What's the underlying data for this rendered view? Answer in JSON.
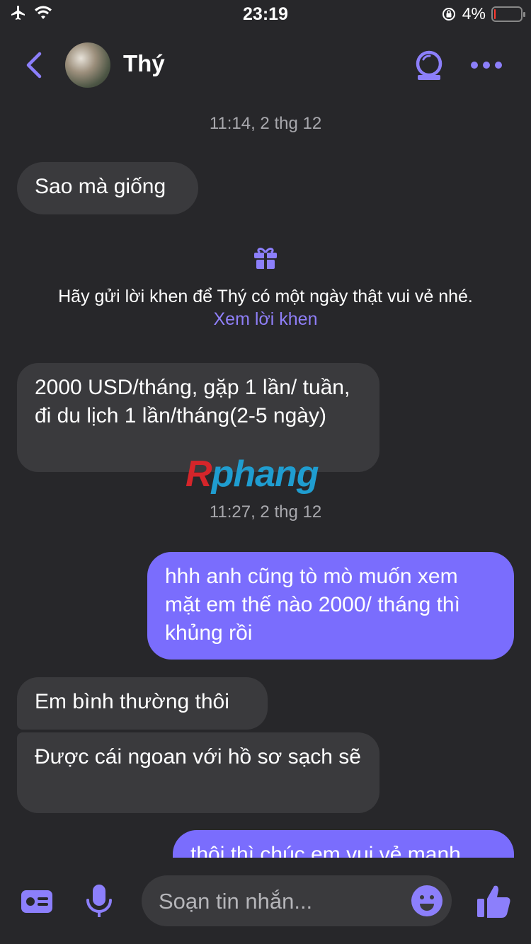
{
  "status_bar": {
    "time": "23:19",
    "battery_text": "4%",
    "battery_level": 0.04
  },
  "header": {
    "contact_name": "Thý",
    "icons": [
      "back-chevron-icon",
      "avatar",
      "camera-icon",
      "more-icon"
    ]
  },
  "messages": {
    "ts1": "11:14, 2 thg 12",
    "m1": "Sao mà giống",
    "compliment_prompt": "Hãy gửi lời khen để Thý có một ngày thật vui vẻ nhé.",
    "compliment_link": "Xem lời khen",
    "m2": "2000 USD/tháng, gặp 1 lần/ tuần, đi du lịch 1 lần/tháng(2-5 ngày)",
    "ts2": "11:27, 2 thg 12",
    "m3": "hhh anh cũng tò mò muốn xem mặt em thế nào 2000/ tháng thì khủng rồi",
    "m4": "Em bình thường thôi",
    "m5": "Được cái ngoan với hồ sơ sạch sẽ",
    "m6": "thôi thì chúc em vui vẻ mạnh"
  },
  "watermark": {
    "part1": "R",
    "part2": "phang"
  },
  "composer": {
    "placeholder": "Soạn tin nhắn..."
  },
  "colors": {
    "accent": "#7a6dfd",
    "background": "#27272a",
    "incoming_bubble": "#3a3a3d"
  }
}
